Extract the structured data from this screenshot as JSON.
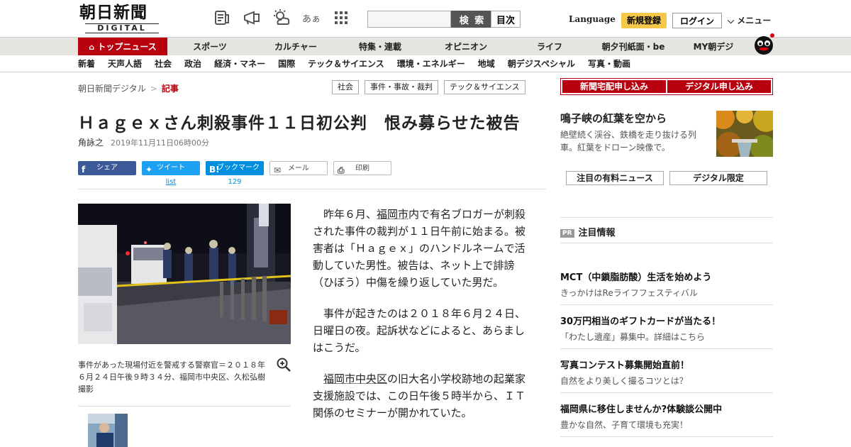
{
  "header": {
    "logo_main": "朝日新聞",
    "logo_sub": "DIGITAL",
    "icons": [
      "newspaper-icon",
      "megaphone-icon",
      "weather-icon",
      "font-size-icon",
      "grid-icon"
    ],
    "font_size_glyph": "あぁ",
    "search_placeholder": "",
    "search_label": "検 索",
    "toc_label": "目次",
    "language_label": "Language",
    "register_label": "新規登録",
    "login_label": "ログイン",
    "menu_label": "メニュー",
    "accent_color": "#b8000f",
    "register_color": "#f5c84a"
  },
  "nav_primary": [
    {
      "label": "トップニュース",
      "active": true
    },
    {
      "label": "スポーツ"
    },
    {
      "label": "カルチャー"
    },
    {
      "label": "特集・連載"
    },
    {
      "label": "オピニオン"
    },
    {
      "label": "ライフ"
    },
    {
      "label": "朝夕刊紙面・be"
    },
    {
      "label": "MY朝デジ"
    }
  ],
  "nav_secondary": [
    "新着",
    "天声人語",
    "社会",
    "政治",
    "経済・マネー",
    "国際",
    "テック＆サイエンス",
    "環境・エネルギー",
    "地域",
    "朝デジスペシャル",
    "写真・動画"
  ],
  "breadcrumb": {
    "home": "朝日新聞デジタル",
    "separator": ">",
    "current": "記事"
  },
  "tags": [
    "社会",
    "事件・事故・裁判",
    "テック＆サイエンス"
  ],
  "article": {
    "title": "Ｈａｇｅｘさん刺殺事件１１日初公判　恨み募らせた被告",
    "author": "角詠之",
    "date": "2019年11月11日06時00分",
    "share": {
      "facebook": "シェア",
      "twitter": "ツイート",
      "twitter_sub": "list",
      "hatena": "ブックマーク",
      "hatena_count": "129",
      "mail": "メール",
      "print": "印刷"
    },
    "photo_caption": "事件があった現場付近を警戒する警察官＝２０１８年６月２４日午後９時３４分、福岡市中央区、久松弘樹撮影",
    "body": {
      "p1_a": "　昨年６月、",
      "p1_link": "福岡市",
      "p1_b": "内で有名ブロガーが刺殺された事件の裁判が１１日午前に始まる。被害者は「Ｈａｇｅｘ」のハンドルネームで活動していた男性。被告は、ネット上で誹謗（ひぼう）中傷を繰り返していた男だ。",
      "p2": "　事件が起きたのは２０１８年６月２４日、日曜日の夜。起訴状などによると、あらましはこうだ。",
      "p3_a": "　",
      "p3_link": "福岡市中央区",
      "p3_b": "の旧大名小学校跡地の起業家支援施設では、この日午後５時半から、ＩＴ関係のセミナーが開かれていた。"
    }
  },
  "sidebar": {
    "subscribe_home": "新聞宅配申し込み",
    "subscribe_digital": "デジタル申し込み",
    "feature_title": "鳴子峡の紅葉を空から",
    "feature_sub": "絶壁続く渓谷、鉄橋を走り抜ける列車。紅葉をドローン映像で。",
    "paid_news": "注目の有料ニュース",
    "digital_only": "デジタル限定",
    "pr_badge": "PR",
    "pr_heading": "注目情報",
    "pr_items": [
      {
        "title": "MCT（中鎖脂肪酸）生活を始めよう",
        "sub": "きっかけはReライフフェスティバル"
      },
      {
        "title": "30万円相当のギフトカードが当たる！",
        "sub": "「わたし遺産」募集中。詳細はこちら"
      },
      {
        "title": "写真コンテスト募集開始直前！",
        "sub": "自然をより美しく撮るコツとは？"
      },
      {
        "title": "福岡県に移住しませんか?体験談公開中",
        "sub": "豊かな自然、子育て環境も充実！"
      }
    ]
  }
}
